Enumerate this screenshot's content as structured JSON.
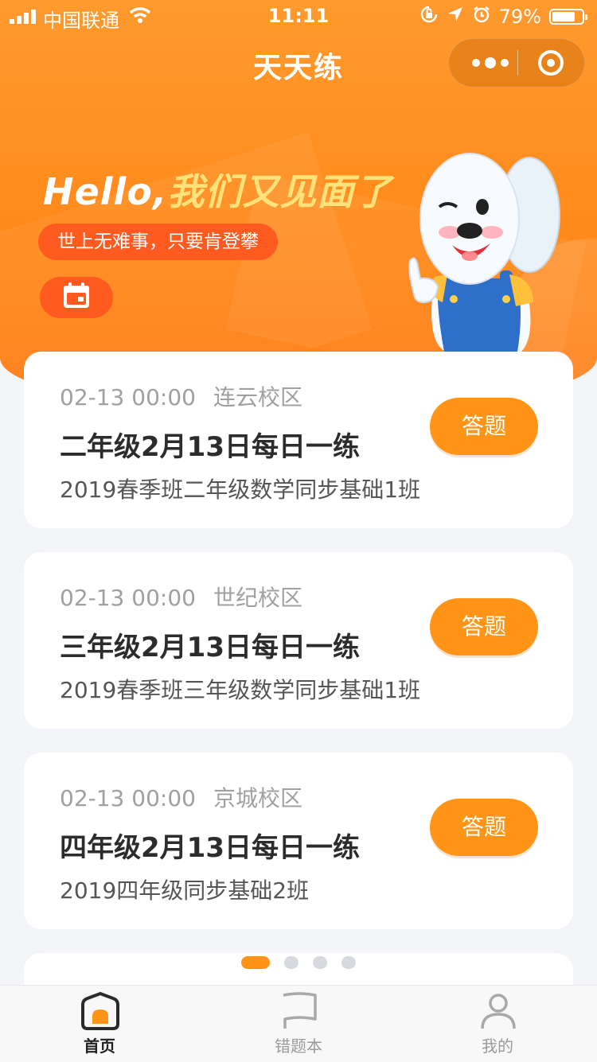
{
  "status_bar": {
    "carrier": "中国联通",
    "time": "11:11",
    "battery": "79%",
    "battery_level": 0.79,
    "icons": [
      "signal-icon",
      "wifi-icon",
      "orientation-lock-icon",
      "location-arrow-icon",
      "alarm-icon",
      "battery-icon"
    ]
  },
  "nav": {
    "title": "天天练",
    "capsule_icons": [
      "more-dots-icon",
      "close-target-icon"
    ]
  },
  "hero": {
    "greeting_prefix": "Hello,",
    "greeting_rest": "我们又见面了",
    "motto": "世上无难事，只要肯登攀",
    "calendar_icon": "calendar-icon",
    "colors": {
      "hero": "#ff8a1a",
      "pill": "#ff5a1f",
      "greeting_accent": "#ffe27a"
    }
  },
  "cards": [
    {
      "datetime": "02-13 00:00",
      "campus": "连云校区",
      "title": "二年级2月13日每日一练",
      "class_name": "2019春季班二年级数学同步基础1班",
      "action": "答题"
    },
    {
      "datetime": "02-13 00:00",
      "campus": "世纪校区",
      "title": "三年级2月13日每日一练",
      "class_name": "2019春季班三年级数学同步基础1班",
      "action": "答题"
    },
    {
      "datetime": "02-13 00:00",
      "campus": "京城校区",
      "title": "四年级2月13日每日一练",
      "class_name": "2019四年级同步基础2班",
      "action": "答题"
    }
  ],
  "pager": {
    "count": 4,
    "active_index": 0,
    "accent": "#ff9416"
  },
  "tabbar": {
    "items": [
      {
        "label": "首页",
        "icon": "home-icon",
        "active": true
      },
      {
        "label": "错题本",
        "icon": "flag-icon",
        "active": false
      },
      {
        "label": "我的",
        "icon": "person-icon",
        "active": false
      }
    ]
  }
}
